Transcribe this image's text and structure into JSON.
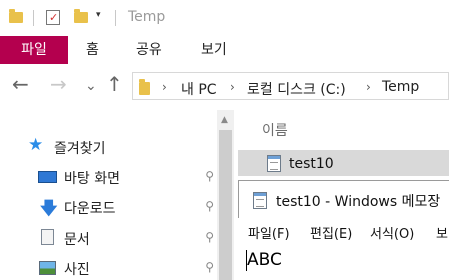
{
  "titlebar": {
    "title": "Temp",
    "qa_dropdown_glyph": "▾",
    "icons": [
      "folder-icon",
      "properties-icon",
      "new-folder-icon"
    ]
  },
  "ribbon": {
    "tabs": [
      "파일",
      "홈",
      "공유",
      "보기"
    ],
    "active_tab_color": "#b4004e"
  },
  "nav": {
    "back_glyph": "←",
    "forward_glyph": "→",
    "recent_glyph": "⌄",
    "up_glyph": "↑"
  },
  "address": {
    "breadcrumb": [
      "내 PC",
      "로컬 디스크 (C:)",
      "Temp"
    ],
    "separator": "›"
  },
  "sidebar": {
    "quick_access_label": "즐겨찾기",
    "items": [
      {
        "label": "바탕 화면",
        "icon": "desktop-icon",
        "pinned": true
      },
      {
        "label": "다운로드",
        "icon": "download-icon",
        "pinned": true
      },
      {
        "label": "문서",
        "icon": "document-icon",
        "pinned": true
      },
      {
        "label": "사진",
        "icon": "pictures-icon",
        "pinned": true
      }
    ],
    "pin_glyph": "📌"
  },
  "content": {
    "column_name": "이름",
    "files": [
      {
        "name": "test10",
        "icon": "notepad-file-icon"
      }
    ]
  },
  "notepad": {
    "title": "test10 - Windows 메모장",
    "menu": [
      "파일(F)",
      "편집(E)",
      "서식(O)",
      "보"
    ],
    "text": "ABC"
  }
}
